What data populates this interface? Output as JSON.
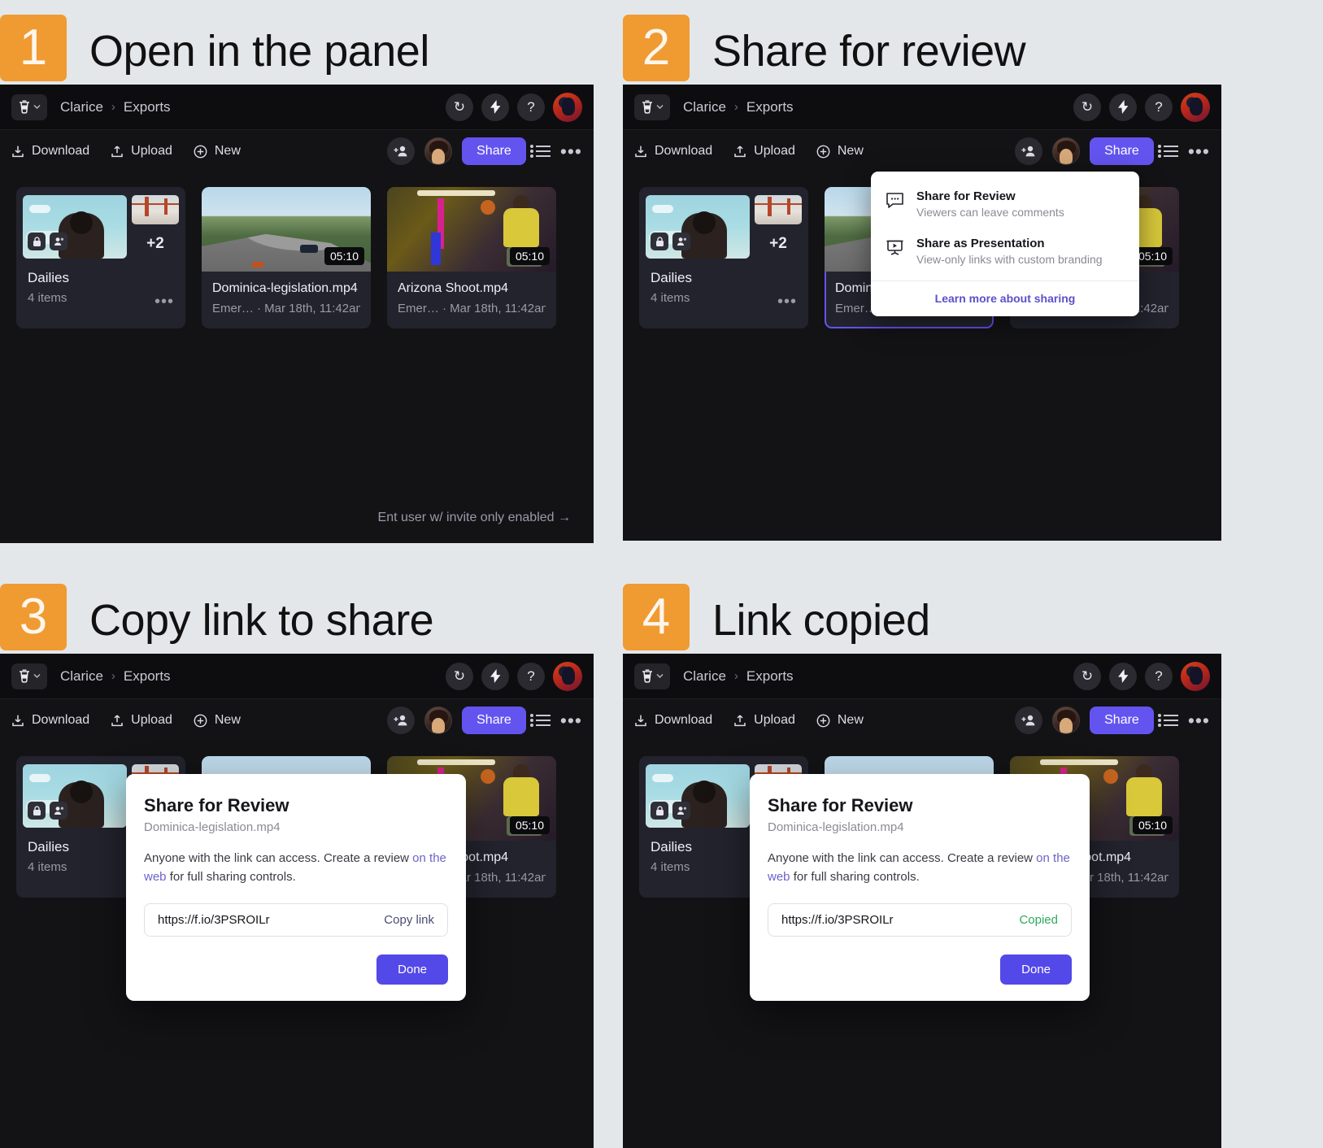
{
  "theme": {
    "page_bg": "#e3e7ea",
    "badge_orange": "#f09a32",
    "accent_purple": "#6354f0",
    "done_purple": "#5348e8",
    "copied_green": "#2fa85c",
    "app_bg": "#131316"
  },
  "steps": [
    {
      "number": "1",
      "title": "Open in the panel"
    },
    {
      "number": "2",
      "title": "Share for review"
    },
    {
      "number": "3",
      "title": "Copy link to share"
    },
    {
      "number": "4",
      "title": "Link copied"
    }
  ],
  "app": {
    "breadcrumb": {
      "root": "Clarice",
      "separator": "›",
      "current": "Exports"
    },
    "titlebar_icons": [
      "refresh-icon",
      "lightning-icon",
      "help-icon",
      "account-avatar"
    ],
    "help_glyph": "?",
    "refresh_glyph": "↻",
    "lightning_glyph": "⚡",
    "actions": [
      {
        "label": "Download",
        "icon": "download-icon"
      },
      {
        "label": "Upload",
        "icon": "upload-icon"
      },
      {
        "label": "New",
        "icon": "plus-circle-icon"
      }
    ],
    "share_label": "Share",
    "overflow_glyph": "•••",
    "cards": [
      {
        "type": "folder",
        "name": "Dailies",
        "subtitle": "4 items",
        "extra_count": "+2",
        "badges": [
          "lock-icon",
          "people-icon"
        ]
      },
      {
        "type": "video",
        "name": "Dominica-legislation.mp4",
        "subtitle": "Emer… · Mar 18th, 11:42am",
        "duration": "05:10"
      },
      {
        "type": "video",
        "name": "Arizona Shoot.mp4",
        "subtitle": "Emer… · Mar 18th, 11:42am",
        "duration": "05:10"
      }
    ],
    "hint": "Ent user w/ invite only enabled →"
  },
  "share_menu": {
    "items": [
      {
        "title": "Share for Review",
        "desc": "Viewers can leave comments",
        "icon": "comment-bubble-icon"
      },
      {
        "title": "Share as Presentation",
        "desc": "View-only links with custom branding",
        "icon": "presentation-icon"
      }
    ],
    "footer_link": "Learn more about sharing"
  },
  "share_dialog": {
    "title": "Share for Review",
    "subtitle": "Dominica-legislation.mp4",
    "body_before": "Anyone with the link can access. Create a review ",
    "body_link": "on the web",
    "body_after": " for full sharing controls.",
    "url": "https://f.io/3PSROILr",
    "copy_label": "Copy link",
    "copied_label": "Copied",
    "done_label": "Done"
  }
}
